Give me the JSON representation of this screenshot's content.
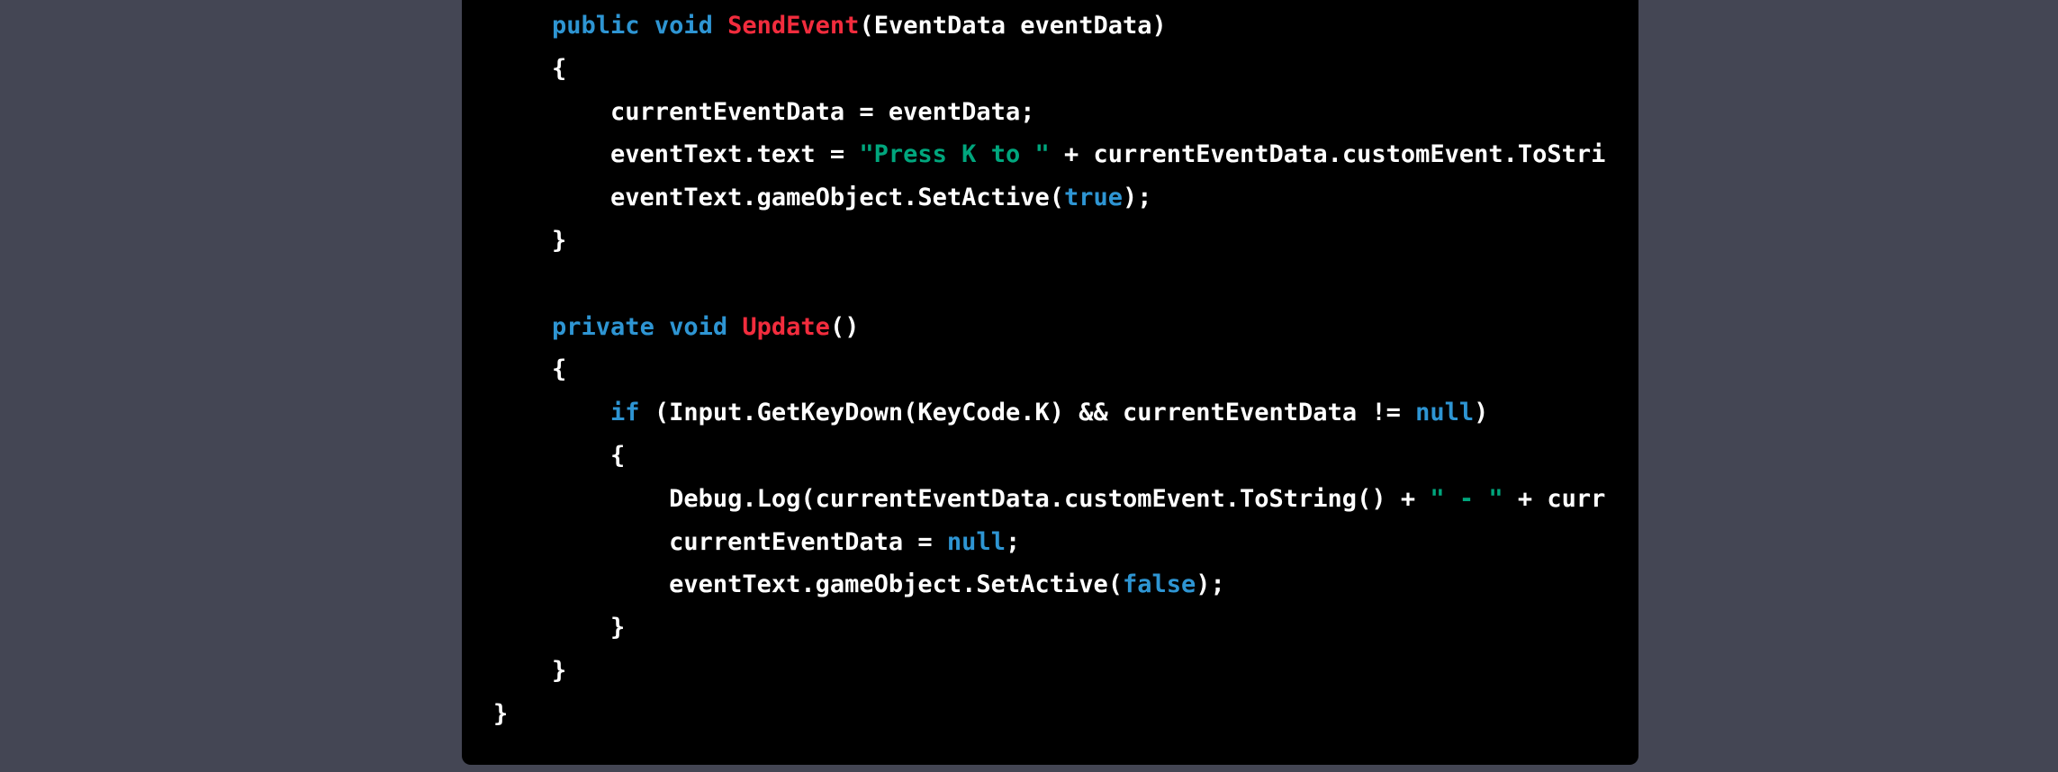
{
  "colors": {
    "background": "#444654",
    "code_bg": "#000000",
    "keyword": "#2e95d3",
    "function_name": "#f22c3d",
    "string": "#00a67d",
    "text": "#ffffff"
  },
  "code_lines": [
    [
      [
        "plain",
        "    "
      ],
      [
        "kw",
        "public"
      ],
      [
        "plain",
        " "
      ],
      [
        "kw",
        "void"
      ],
      [
        "plain",
        " "
      ],
      [
        "title",
        "SendEvent"
      ],
      [
        "plain",
        "(EventData eventData)"
      ]
    ],
    [
      [
        "plain",
        "    {"
      ]
    ],
    [
      [
        "plain",
        "        currentEventData = eventData;"
      ]
    ],
    [
      [
        "plain",
        "        eventText.text = "
      ],
      [
        "str",
        "\"Press K to \""
      ],
      [
        "plain",
        " + currentEventData.customEvent.ToStri"
      ]
    ],
    [
      [
        "plain",
        "        eventText.gameObject.SetActive("
      ],
      [
        "kw",
        "true"
      ],
      [
        "plain",
        ");"
      ]
    ],
    [
      [
        "plain",
        "    }"
      ]
    ],
    [
      [
        "plain",
        ""
      ]
    ],
    [
      [
        "plain",
        "    "
      ],
      [
        "kw",
        "private"
      ],
      [
        "plain",
        " "
      ],
      [
        "kw",
        "void"
      ],
      [
        "plain",
        " "
      ],
      [
        "title",
        "Update"
      ],
      [
        "plain",
        "()"
      ]
    ],
    [
      [
        "plain",
        "    {"
      ]
    ],
    [
      [
        "plain",
        "        "
      ],
      [
        "kw",
        "if"
      ],
      [
        "plain",
        " (Input.GetKeyDown(KeyCode.K) && currentEventData != "
      ],
      [
        "kw",
        "null"
      ],
      [
        "plain",
        ")"
      ]
    ],
    [
      [
        "plain",
        "        {"
      ]
    ],
    [
      [
        "plain",
        "            Debug.Log(currentEventData.customEvent.ToString() + "
      ],
      [
        "str",
        "\" - \""
      ],
      [
        "plain",
        " + curr"
      ]
    ],
    [
      [
        "plain",
        "            currentEventData = "
      ],
      [
        "kw",
        "null"
      ],
      [
        "plain",
        ";"
      ]
    ],
    [
      [
        "plain",
        "            eventText.gameObject.SetActive("
      ],
      [
        "kw",
        "false"
      ],
      [
        "plain",
        ");"
      ]
    ],
    [
      [
        "plain",
        "        }"
      ]
    ],
    [
      [
        "plain",
        "    }"
      ]
    ],
    [
      [
        "plain",
        "}"
      ]
    ]
  ]
}
